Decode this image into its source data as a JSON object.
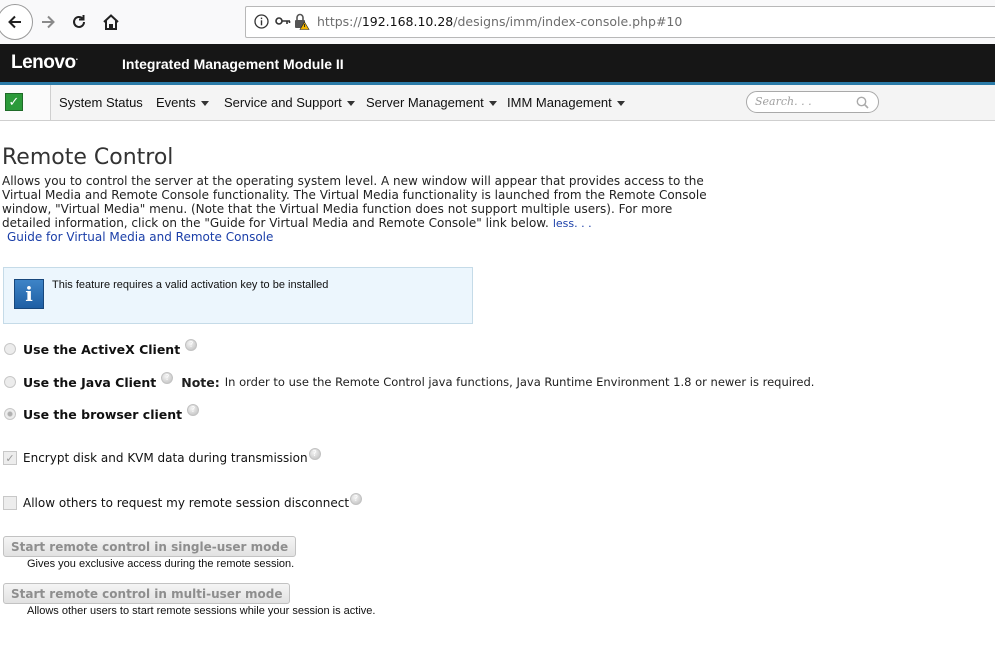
{
  "browser": {
    "url_prefix": "https://",
    "url_host": "192.168.10.28",
    "url_path": "/designs/imm/index-console.php#10",
    "icons": [
      "back-arrow-icon",
      "forward-arrow-icon",
      "reload-icon",
      "home-icon",
      "info-icon",
      "key-icon",
      "lock-warning-icon"
    ]
  },
  "header": {
    "brand": "Lenovo",
    "brand_mark": ".",
    "title": "Integrated Management Module II",
    "accent_color": "#2b7ba8"
  },
  "menu": {
    "status_icon": "status-ok-check-icon",
    "items": [
      {
        "label": "System Status",
        "dropdown": false
      },
      {
        "label": "Events",
        "dropdown": true
      },
      {
        "label": "Service and Support",
        "dropdown": true
      },
      {
        "label": "Server Management",
        "dropdown": true
      },
      {
        "label": "IMM Management",
        "dropdown": true
      }
    ],
    "search_placeholder": "Search. . ."
  },
  "page": {
    "title": "Remote Control",
    "description": "Allows you to control the server at the operating system level. A new window will appear that provides access to the Virtual Media and Remote Console functionality. The Virtual Media functionality is launched from the Remote Console window, \"Virtual Media\" menu. (Note that the Virtual Media function does not support multiple users). For more detailed information, click on the \"Guide for Virtual Media and Remote Console\" link below.",
    "less_link": "less. . .",
    "guide_link": "Guide for Virtual Media and Remote Console",
    "info_message": "This feature requires a valid activation key to be installed",
    "client_options": [
      {
        "label": "Use the ActiveX Client",
        "selected": false
      },
      {
        "label": "Use the Java Client",
        "selected": false
      },
      {
        "label": "Use the browser client",
        "selected": true
      }
    ],
    "java_note_label": "Note:",
    "java_note_text": "In order to use the Remote Control java functions, Java Runtime Environment 1.8 or newer is required.",
    "checkboxes": [
      {
        "label": "Encrypt disk and KVM data during transmission",
        "checked": true
      },
      {
        "label": "Allow others to request my remote session disconnect",
        "checked": false
      }
    ],
    "buttons": [
      {
        "label": "Start remote control in single-user mode",
        "description": "Gives you exclusive access during the remote session.",
        "enabled": false
      },
      {
        "label": "Start remote control in multi-user mode",
        "description": "Allows other users to start remote sessions while your session is active.",
        "enabled": false
      }
    ]
  }
}
